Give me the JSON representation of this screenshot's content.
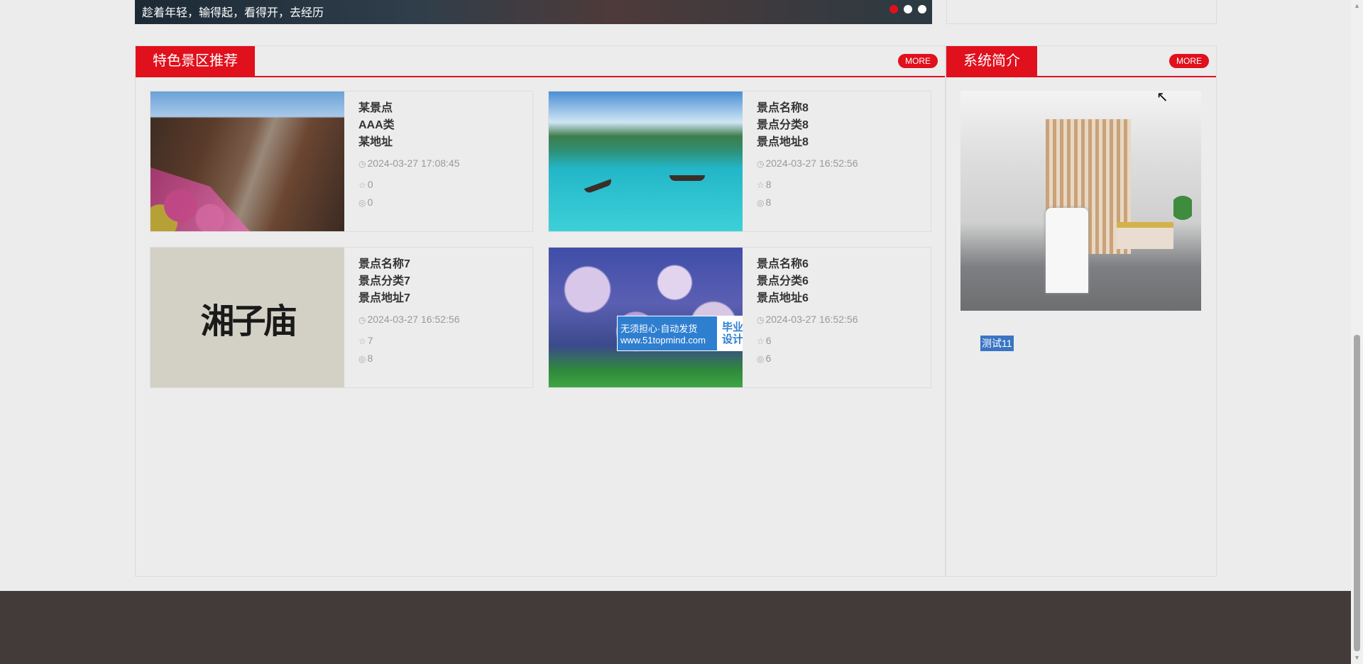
{
  "banner": {
    "text": "趁着年轻，输得起，看得开，去经历",
    "dots": [
      true,
      false,
      false
    ]
  },
  "featured": {
    "title": "特色景区推荐",
    "more": "MORE",
    "cards": [
      {
        "name": "某景点",
        "category": "AAA类",
        "address": "某地址",
        "time": "2024-03-27 17:08:45",
        "likes": "0",
        "views": "0",
        "image": "street"
      },
      {
        "name": "景点名称8",
        "category": "景点分类8",
        "address": "景点地址8",
        "time": "2024-03-27 16:52:56",
        "likes": "8",
        "views": "8",
        "image": "lake"
      },
      {
        "name": "景点名称7",
        "category": "景点分类7",
        "address": "景点地址7",
        "time": "2024-03-27 16:52:56",
        "likes": "7",
        "views": "8",
        "image": "calligraphy"
      },
      {
        "name": "景点名称6",
        "category": "景点分类6",
        "address": "景点地址6",
        "time": "2024-03-27 16:52:56",
        "likes": "6",
        "views": "6",
        "image": "blossom"
      }
    ],
    "calligraphy_text": "湘子庙",
    "watermark": {
      "line1": "无须担心·自动发货",
      "line2": "www.51topmind.com",
      "badge1": "毕业",
      "badge2": "设计"
    }
  },
  "intro": {
    "title": "系统简介",
    "more": "MORE",
    "text": "测试11"
  },
  "icons": {
    "clock": "clock-icon",
    "star": "star-icon",
    "eye": "eye-icon"
  },
  "colors": {
    "accent": "#e0101c",
    "footer": "#433a3a",
    "background": "#ececec"
  }
}
